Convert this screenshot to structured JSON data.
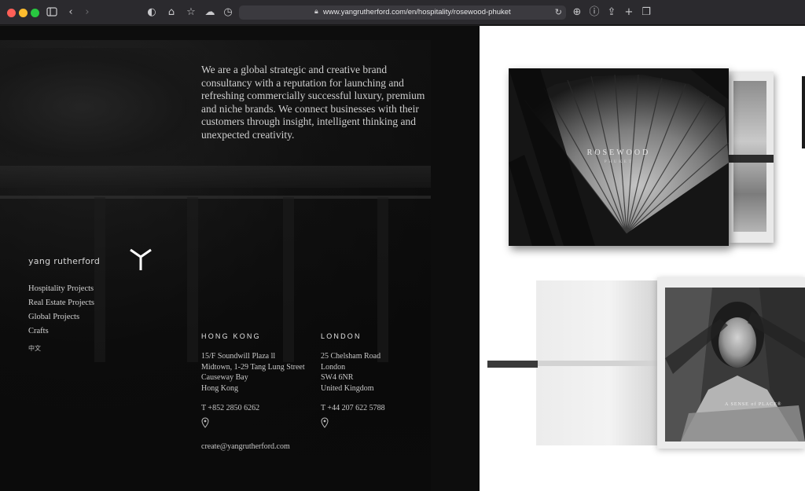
{
  "browser": {
    "url": "www.yangrutherford.com/en/hospitality/rosewood-phuket",
    "icons": [
      "sidebar-icon",
      "back-icon",
      "forward-icon",
      "shield-icon",
      "home-icon",
      "star-icon",
      "cloud-icon",
      "history-icon",
      "reload-icon",
      "download-icon",
      "info-icon",
      "share-icon",
      "new-tab-icon",
      "tabs-icon"
    ]
  },
  "site": {
    "intro": "We are a global strategic and creative brand consultancy with a reputation for launching and refreshing commercially successful luxury, premium and niche brands. We connect businesses with their customers through insight, intelligent thinking and unexpected creativity.",
    "brand": "yang rutherford",
    "nav": [
      "Hospitality Projects",
      "Real Estate Projects",
      "Global Projects",
      "Crafts"
    ],
    "language": "中文",
    "offices": [
      {
        "city": "HONG KONG",
        "address": [
          "15/F Soundwill Plaza ll",
          "Midtown, 1-29 Tang Lung Street",
          "Causeway Bay",
          "Hong Kong"
        ],
        "phone": "T +852 2850 6262"
      },
      {
        "city": "LONDON",
        "address": [
          "25 Chelsham Road",
          "London",
          "SW4 6NR",
          "United Kingdom"
        ],
        "phone": "T +44 207 622 5788"
      }
    ],
    "email": "create@yangrutherford.com"
  },
  "gallery": {
    "book1_title": "ROSEWOOD",
    "book1_subtitle": "PHUKET",
    "book2_caption": "A SENSE of PLACE®"
  }
}
